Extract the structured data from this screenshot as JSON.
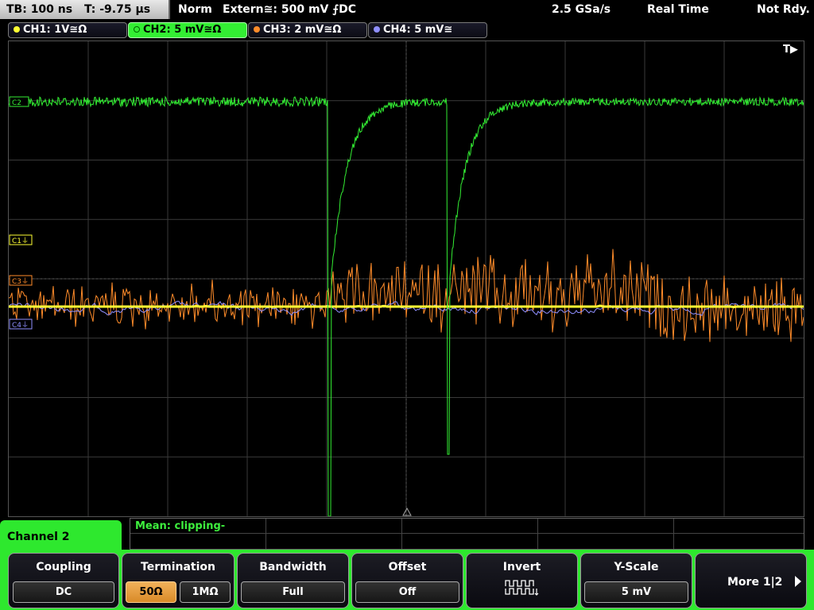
{
  "status": {
    "timebase": "TB: 100 ns",
    "trigger_time": "T: -9.75 µs",
    "mode": "Norm",
    "trigger_source": "Extern≅: 500 mV ⨍DC",
    "sample_rate": "2.5 GSa/s",
    "acq_mode": "Real Time",
    "state": "Not Rdy."
  },
  "channels": [
    {
      "label": "CH1: 1V≅Ω",
      "color": "#ffff33",
      "active": false
    },
    {
      "label": "CH2: 5 mV≅Ω",
      "color": "#33ee33",
      "active": true
    },
    {
      "label": "CH3: 2 mV≅Ω",
      "color": "#ff8c2a",
      "active": false
    },
    {
      "label": "CH4: 5 mV≅",
      "color": "#8f8fff",
      "active": false
    }
  ],
  "scope": {
    "trigger_marker": "T▶",
    "markers": [
      {
        "label": "C1⏚",
        "color": "#ffff33"
      },
      {
        "label": "C3⏚",
        "color": "#ff8c2a"
      },
      {
        "label": "C4⏚",
        "color": "#8f8fff"
      },
      {
        "label": "C2",
        "color": "#33ee33"
      }
    ]
  },
  "panel": {
    "channel_title": "Channel 2",
    "measurement": "Mean: clipping-"
  },
  "softkeys": {
    "coupling": {
      "title": "Coupling",
      "value": "DC"
    },
    "termination": {
      "title": "Termination",
      "options": [
        "50Ω",
        "1MΩ"
      ],
      "selected": "50Ω"
    },
    "bandwidth": {
      "title": "Bandwidth",
      "value": "Full"
    },
    "offset": {
      "title": "Offset",
      "value": "Off"
    },
    "invert": {
      "title": "Invert",
      "icon": "invert-waveform-icon"
    },
    "yscale": {
      "title": "Y-Scale",
      "value": "5 mV"
    },
    "more": {
      "label": "More 1|2"
    }
  }
}
